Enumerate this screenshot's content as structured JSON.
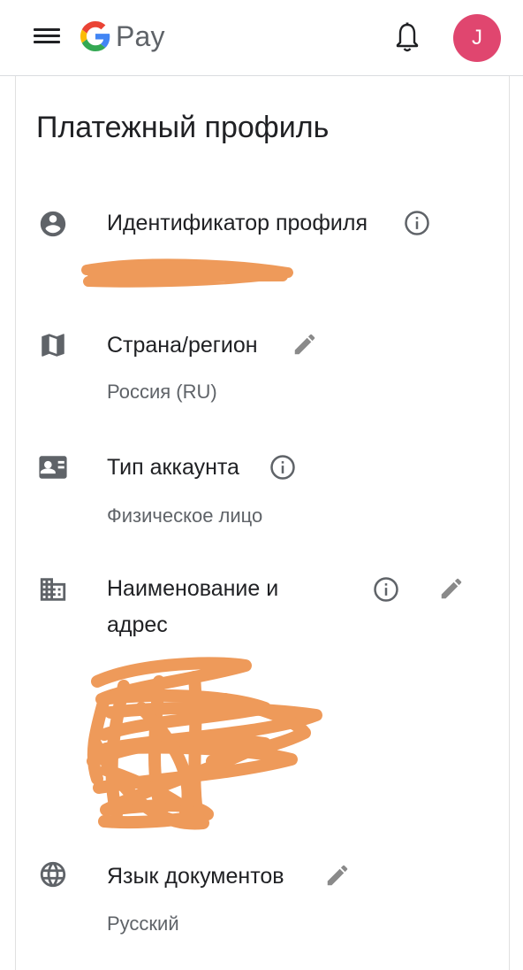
{
  "app": {
    "logo_letter": "G",
    "logo_text": "Pay",
    "avatar_initial": "J",
    "avatar_color": "#e0466f"
  },
  "page": {
    "title": "Платежный профиль"
  },
  "sections": {
    "profile_id": {
      "label": "Идентификатор профиля",
      "icon": "account-circle-icon"
    },
    "country": {
      "label": "Страна/регион",
      "value": "Россия (RU)",
      "icon": "map-icon"
    },
    "account_type": {
      "label": "Тип аккаунта",
      "value": "Физическое лицо",
      "icon": "contact-card-icon"
    },
    "name_address": {
      "label_line1": "Наименование и",
      "label_line2": "адрес",
      "icon": "building-icon"
    },
    "doc_language": {
      "label": "Язык документов",
      "value": "Русский",
      "icon": "globe-icon"
    }
  },
  "colors": {
    "accent_text": "#202124",
    "secondary_text": "#5f6368",
    "icon_gray": "#5f6368",
    "redaction_orange": "#ee9a5a"
  }
}
